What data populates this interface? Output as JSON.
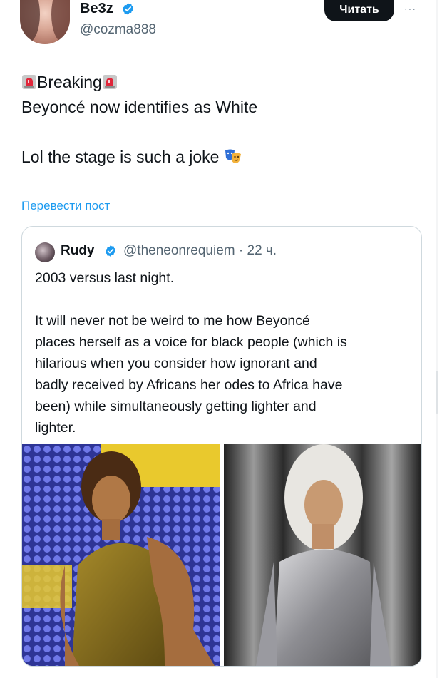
{
  "author": {
    "display_name": "Be3z",
    "handle": "@cozma888"
  },
  "follow_label": "Читать",
  "more_label": "···",
  "post": {
    "line1": "Breaking",
    "line2": "Beyoncé now identifies as White",
    "line3": "Lol the stage is such a joke"
  },
  "translate_label": "Перевести пост",
  "quote": {
    "display_name": "Rudy",
    "handle_time": "@theneonrequiem · 22 ч.",
    "line1": "2003 versus last night.",
    "body_lines": [
      "It will never not be weird to me how Beyoncé",
      "places herself as a voice for black people (which is",
      "hilarious when you consider how ignorant and",
      "badly received by Africans her odes to Africa have",
      "been) while simultaneously getting lighter and",
      "lighter."
    ]
  },
  "icons": [
    "siren-icon",
    "masks-icon",
    "verified-badge-icon",
    "more-icon"
  ],
  "colors": {
    "link": "#1d9bf0",
    "verified": "#1d9bf0",
    "secondary_text": "#536471",
    "button": "#0f1419"
  }
}
